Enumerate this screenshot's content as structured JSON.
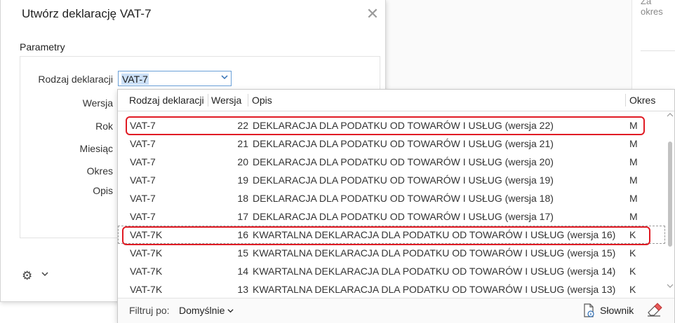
{
  "background": {
    "partial_text": "Za okres"
  },
  "dialog": {
    "title": "Utwórz deklarację VAT-7",
    "section_title": "Parametry",
    "fields": {
      "rodzaj_label": "Rodzaj deklaracji",
      "wersja_label": "Wersja",
      "rok_label": "Rok",
      "miesiac_label": "Miesiąc",
      "okres_label": "Okres",
      "opis_label": "Opis"
    },
    "rodzaj_value": "VAT-7"
  },
  "dropdown": {
    "columns": [
      "Rodzaj deklaracji",
      "Wersja",
      "Opis",
      "Okres"
    ],
    "rows": [
      {
        "rodzaj": "VAT-7",
        "wersja": "22",
        "opis": "DEKLARACJA DLA PODATKU OD TOWARÓW I USŁUG (wersja 22)",
        "okres": "M"
      },
      {
        "rodzaj": "VAT-7",
        "wersja": "21",
        "opis": "DEKLARACJA DLA PODATKU OD TOWARÓW I USŁUG (wersja 21)",
        "okres": "M"
      },
      {
        "rodzaj": "VAT-7",
        "wersja": "20",
        "opis": "DEKLARACJA DLA PODATKU OD TOWARÓW I USŁUG (wersja 20)",
        "okres": "M"
      },
      {
        "rodzaj": "VAT-7",
        "wersja": "19",
        "opis": "DEKLARACJA DLA PODATKU OD TOWARÓW I USŁUG (wersja 19)",
        "okres": "M"
      },
      {
        "rodzaj": "VAT-7",
        "wersja": "18",
        "opis": "DEKLARACJA DLA PODATKU OD TOWARÓW I USŁUG (wersja 18)",
        "okres": "M"
      },
      {
        "rodzaj": "VAT-7",
        "wersja": "17",
        "opis": "DEKLARACJA DLA PODATKU OD TOWARÓW I USŁUG (wersja 17)",
        "okres": "M"
      },
      {
        "rodzaj": "VAT-7K",
        "wersja": "16",
        "opis": "KWARTALNA DEKLARACJA DLA PODATKU OD TOWARÓW I USŁUG (wersja 16)",
        "okres": "K"
      },
      {
        "rodzaj": "VAT-7K",
        "wersja": "15",
        "opis": "KWARTALNA DEKLARACJA DLA PODATKU OD TOWARÓW I USŁUG (wersja 15)",
        "okres": "K"
      },
      {
        "rodzaj": "VAT-7K",
        "wersja": "14",
        "opis": "KWARTALNA DEKLARACJA DLA PODATKU OD TOWARÓW I USŁUG (wersja 14)",
        "okres": "K"
      },
      {
        "rodzaj": "VAT-7K",
        "wersja": "13",
        "opis": "KWARTALNA DEKLARACJA DLA PODATKU OD TOWARÓW I USŁUG (wersja 13)",
        "okres": "K"
      }
    ],
    "highlighted_rows": [
      0,
      6
    ],
    "selected_row": 6,
    "footer": {
      "filter_label": "Filtruj po:",
      "filter_value": "Domyślnie",
      "slownik_label": "Słownik"
    }
  },
  "icons": {
    "close": "close-icon",
    "gear": "gear-icon",
    "chevron": "chevron-down-icon",
    "dictionary": "dictionary-icon",
    "eraser": "eraser-icon"
  },
  "colors": {
    "highlight": "#e01b24",
    "select_border": "#6aa0d8",
    "selection_bg": "#cce0f7"
  }
}
